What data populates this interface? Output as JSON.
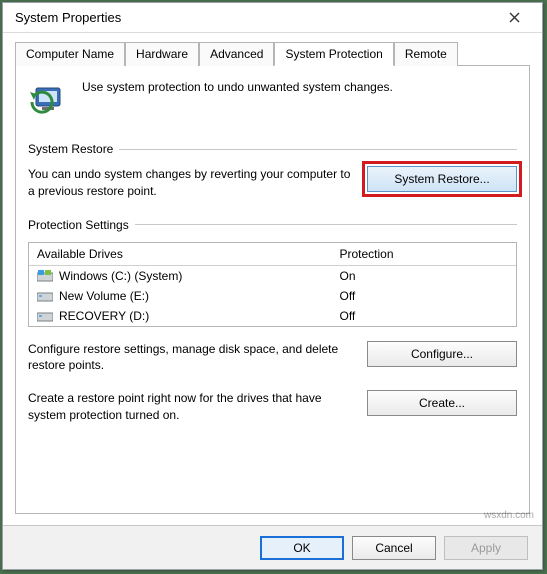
{
  "window": {
    "title": "System Properties"
  },
  "tabs": [
    {
      "label": "Computer Name",
      "active": false
    },
    {
      "label": "Hardware",
      "active": false
    },
    {
      "label": "Advanced",
      "active": false
    },
    {
      "label": "System Protection",
      "active": true
    },
    {
      "label": "Remote",
      "active": false
    }
  ],
  "intro_text": "Use system protection to undo unwanted system changes.",
  "restore_section": {
    "title": "System Restore",
    "text": "You can undo system changes by reverting your computer to a previous restore point.",
    "button_label": "System Restore..."
  },
  "protection_section": {
    "title": "Protection Settings",
    "columns": {
      "drives": "Available Drives",
      "protection": "Protection"
    },
    "rows": [
      {
        "icon": "drive-windows",
        "name": "Windows (C:) (System)",
        "protection": "On"
      },
      {
        "icon": "drive-generic",
        "name": "New Volume (E:)",
        "protection": "Off"
      },
      {
        "icon": "drive-generic",
        "name": "RECOVERY (D:)",
        "protection": "Off"
      }
    ],
    "configure_text": "Configure restore settings, manage disk space, and delete restore points.",
    "configure_button": "Configure...",
    "create_text": "Create a restore point right now for the drives that have system protection turned on.",
    "create_button": "Create..."
  },
  "buttons": {
    "ok": "OK",
    "cancel": "Cancel",
    "apply": "Apply"
  },
  "watermark": "wsxdn.com"
}
